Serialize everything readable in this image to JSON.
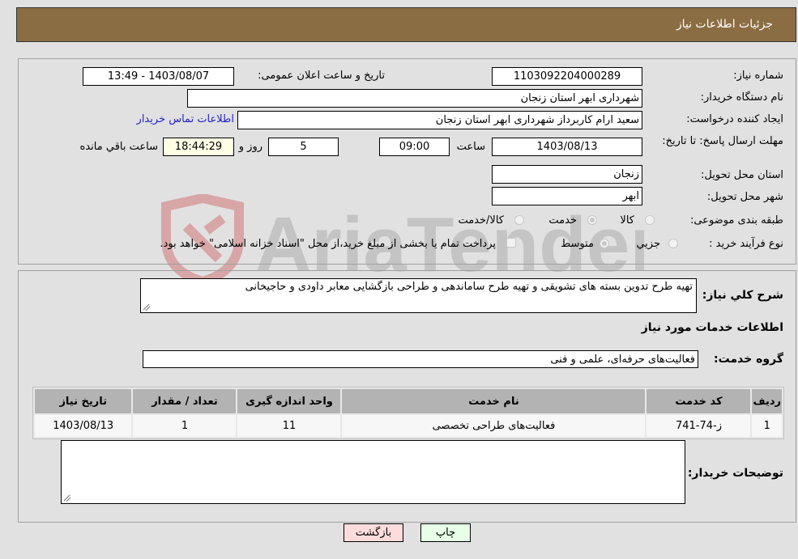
{
  "header": {
    "title": "جزئیات اطلاعات نیاز"
  },
  "form": {
    "need_number": {
      "label": "شماره نیاز:",
      "value": "1103092204000289"
    },
    "announce_datetime": {
      "label": "تاریخ و ساعت اعلان عمومی:",
      "value": "1403/08/07 - 13:49"
    },
    "buyer_org": {
      "label": "نام دستگاه خریدار:",
      "value": "شهرداری ابهر استان زنجان"
    },
    "requester": {
      "label": "ایجاد کننده درخواست:",
      "value": "سعید ارام کاربرداز  شهرداری ابهر استان زنجان"
    },
    "buyer_contact_link": "اطلاعات تماس خریدار",
    "deadline": {
      "label": "مهلت ارسال پاسخ: تا تاریخ:",
      "date": "1403/08/13",
      "time_label": "ساعت",
      "time": "09:00",
      "days": "5",
      "days_label": "روز و",
      "remaining": "18:44:29",
      "remaining_label": "ساعت باقي مانده"
    },
    "province": {
      "label": "استان محل تحویل:",
      "value": "زنجان"
    },
    "city": {
      "label": "شهر محل تحویل:",
      "value": "ابهر"
    },
    "category": {
      "label": "طبقه بندی موضوعی:",
      "options": [
        "کالا",
        "خدمت",
        "کالا/خدمت"
      ],
      "selected": "خدمت"
    },
    "purchase_type": {
      "label": "نوع فرآیند خرید :",
      "options": [
        "جزيي",
        "متوسط"
      ],
      "selected": "متوسط",
      "payment_note": "پرداخت تمام یا بخشی از مبلغ خرید،از محل \"اسناد خزانه اسلامی\" خواهد بود."
    }
  },
  "description": {
    "label": "شرح کلي نیاز:",
    "value": "تهیه طرح تدوین بسته های تشویقی و تهیه طرح ساماندهی و طراحی بازگشایی معابر داودی و حاجیخانی"
  },
  "services_section": {
    "title": "اطلاعات خدمات مورد نیاز",
    "group_label": "گروه خدمت:",
    "group_value": "فعالیت‌های حرفه‌ای، علمی و فنی",
    "table": {
      "headers": [
        "ردیف",
        "کد خدمت",
        "نام خدمت",
        "واحد اندازه گیری",
        "تعداد / مقدار",
        "تاریخ نیاز"
      ],
      "rows": [
        [
          "1",
          "ز-74-741",
          "فعالیت‌های طراحی تخصصی",
          "11",
          "1",
          "1403/08/13"
        ]
      ]
    }
  },
  "buyer_notes": {
    "label": "توضیحات خریدار:",
    "value": ""
  },
  "buttons": {
    "print": "چاپ",
    "back": "بازگشت"
  },
  "colors": {
    "header": "#8b6d43",
    "print_bg": "#e6ffe6",
    "back_bg": "#ffdcdc",
    "link": "#2222cc"
  },
  "watermark": "AriaTender.neT"
}
